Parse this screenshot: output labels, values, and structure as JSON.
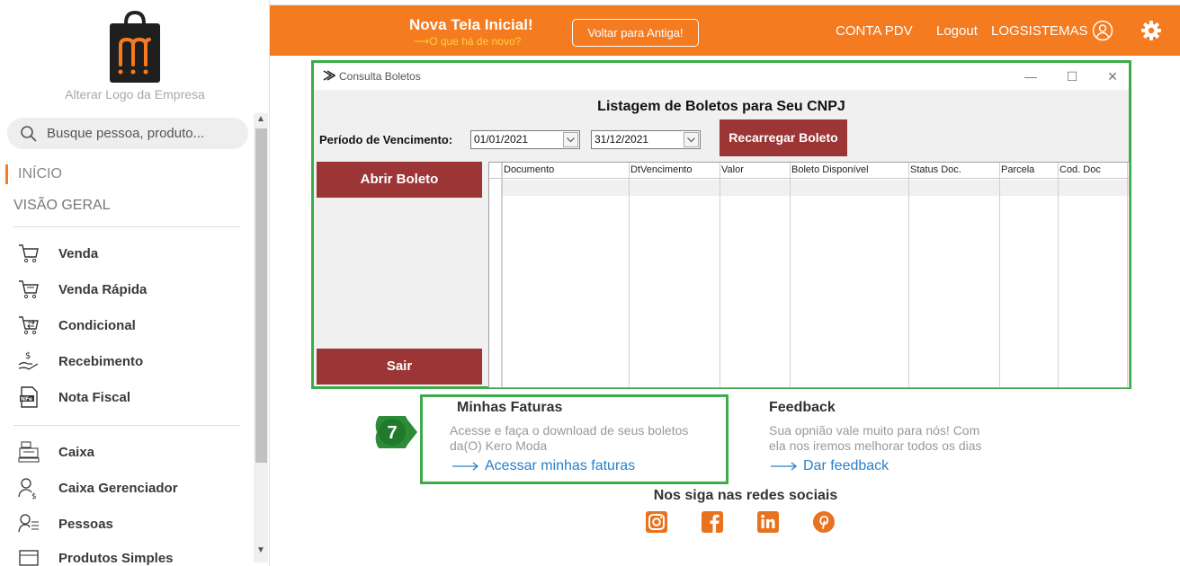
{
  "sidebar": {
    "logo_caption": "Alterar Logo da Empresa",
    "search_placeholder": "Busque pessoa, produto...",
    "section_inicio": "INÍCIO",
    "section_visao": "VISÃO GERAL",
    "items": [
      {
        "label": "Venda",
        "icon": "cart-icon"
      },
      {
        "label": "Venda Rápida",
        "icon": "cart-fast-icon"
      },
      {
        "label": "Condicional",
        "icon": "cart-swap-icon"
      },
      {
        "label": "Recebimento",
        "icon": "money-hand-icon"
      },
      {
        "label": "Nota Fiscal",
        "icon": "nfe-document-icon"
      },
      {
        "label": "Caixa",
        "icon": "cash-register-icon"
      },
      {
        "label": "Caixa Gerenciador",
        "icon": "user-money-icon"
      },
      {
        "label": "Pessoas",
        "icon": "person-list-icon"
      },
      {
        "label": "Produtos Simples",
        "icon": "box-icon"
      }
    ]
  },
  "topbar": {
    "title": "Nova Tela Inicial!",
    "subtitle": "⟶O que há de novo?",
    "back_button": "Voltar para Antiga!",
    "conta_pdv": "CONTA PDV",
    "logout": "Logout",
    "username": "LOGSISTEMAS",
    "colors": {
      "bar": "#f47b20",
      "subtitle": "#ffd23a"
    }
  },
  "dialog": {
    "window_title": "Consulta Boletos",
    "heading": "Listagem de Boletos para Seu CNPJ",
    "period_label": "Período de Vencimento:",
    "date_start": "01/01/2021",
    "date_end": "31/12/2021",
    "reload_button": "Recarregar Boleto",
    "open_button": "Abrir Boleto",
    "exit_button": "Sair",
    "columns": [
      "Documento",
      "DtVencimento",
      "Valor",
      "Boleto Disponível",
      "Status Doc.",
      "Parcela",
      "Cod. Doc"
    ],
    "rows": [],
    "colors": {
      "button": "#9c3535",
      "highlight": "#3cab4a"
    }
  },
  "faturas": {
    "step": "7",
    "title": "Minhas Faturas",
    "desc_line1": "Acesse e faça o download de seus boletos",
    "desc_line2": "da(O) Kero Moda",
    "link": "Acessar minhas faturas"
  },
  "feedback": {
    "title": "Feedback",
    "desc_line1": "Sua opnião vale muito para nós! Com",
    "desc_line2": "ela nos iremos melhorar todos os dias",
    "link": "Dar feedback"
  },
  "social": {
    "title": "Nos siga nas redes sociais",
    "icons": [
      "instagram-icon",
      "facebook-icon",
      "linkedin-icon",
      "pinterest-icon"
    ],
    "color": "#e8731f"
  }
}
